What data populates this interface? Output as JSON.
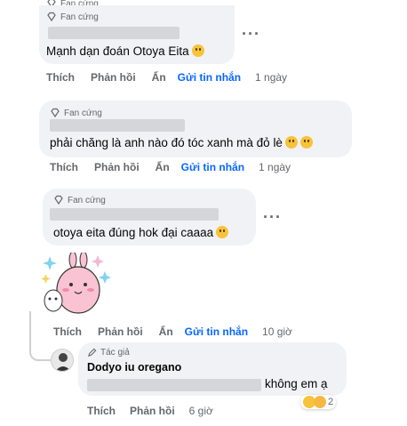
{
  "comments": [
    {
      "badge": "Fan cứng",
      "text": "Mạnh dạn đoán Otoya Eita",
      "actions": {
        "like": "Thích",
        "reply": "Phản hồi",
        "hide": "Ẩn",
        "message": "Gửi tin nhắn",
        "time": "1 ngày"
      }
    },
    {
      "badge": "Fan cứng",
      "text": "phải chăng là anh nào đó tóc xanh mà đỏ lè",
      "actions": {
        "like": "Thích",
        "reply": "Phản hồi",
        "hide": "Ẩn",
        "message": "Gửi tin nhắn",
        "time": "1 ngày"
      }
    },
    {
      "badge": "Fan cứng",
      "text": "otoya eita đúng hok đại caaaa",
      "actions": {
        "like": "Thích",
        "reply": "Phản hồi",
        "hide": "Ẩn",
        "message": "Gửi tin nhắn",
        "time": "10 giờ"
      }
    }
  ],
  "reply": {
    "badge": "Tác giả",
    "author": "Dodyo iu oregano",
    "text": "không em ạ",
    "reaction_count": "2",
    "actions": {
      "like": "Thích",
      "reply": "Phản hồi",
      "time": "6 giờ"
    }
  },
  "top_cut": {
    "badge": "Fan cứng"
  },
  "icons": {
    "more": "more-horizontal-icon",
    "badge": "diamond-icon"
  }
}
